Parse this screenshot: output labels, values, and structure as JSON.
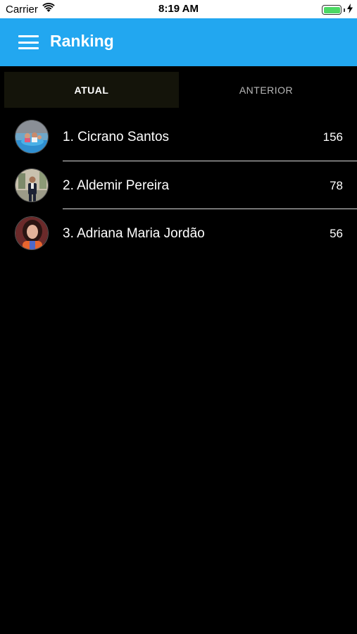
{
  "status_bar": {
    "carrier": "Carrier",
    "time": "8:19 AM"
  },
  "app_bar": {
    "title": "Ranking"
  },
  "tabs": [
    {
      "label": "ATUAL",
      "active": true
    },
    {
      "label": "ANTERIOR",
      "active": false
    }
  ],
  "ranking": [
    {
      "name": "1. Cicrano Santos",
      "score": "156",
      "avatar_icon": "pool-photo-avatar"
    },
    {
      "name": "2. Aldemir Pereira",
      "score": "78",
      "avatar_icon": "man-suit-photo-avatar"
    },
    {
      "name": "3. Adriana Maria Jordão",
      "score": "56",
      "avatar_icon": "woman-photo-avatar"
    }
  ],
  "colors": {
    "app_bar": "#22a7f0",
    "background": "#000000",
    "active_tab": "#14140a",
    "battery": "#4cd964"
  }
}
